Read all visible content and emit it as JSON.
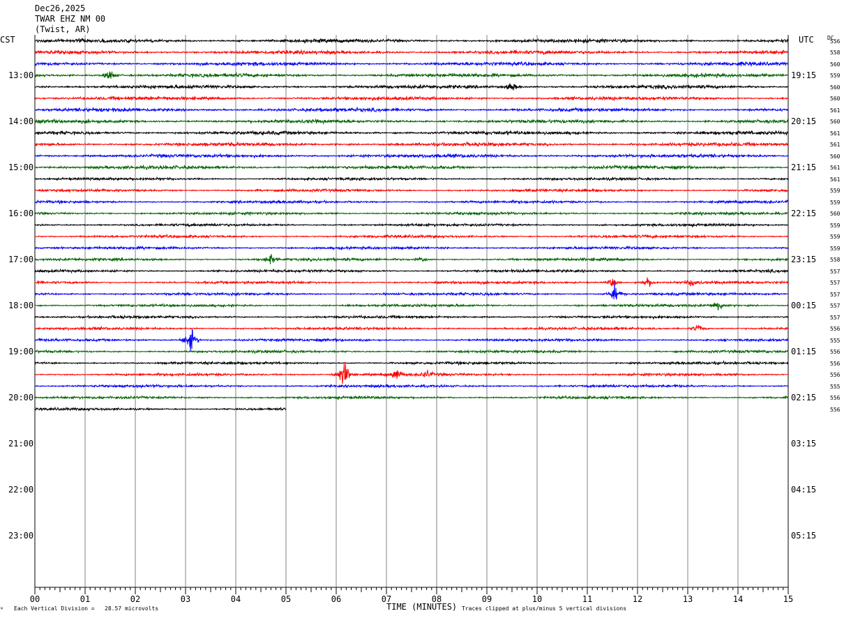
{
  "header": {
    "date": "Dec26,2025",
    "station": "TWAR EHZ NM 00",
    "location": "(Twist, AR)",
    "left_timezone": "CST",
    "right_timezone": "UTC",
    "dc_label": "DC"
  },
  "footer": {
    "vertical_division": "Each Vertical Division =   28.57 microvolts",
    "axis_title": "TIME (MINUTES)",
    "clip_note": "Traces clipped at plus/minus 5 vertical divisions"
  },
  "chart_data": {
    "type": "line",
    "title": "TWAR EHZ NM 00",
    "xlabel": "TIME (MINUTES)",
    "xlim": [
      0,
      15
    ],
    "x_ticks": [
      "00",
      "01",
      "02",
      "03",
      "04",
      "05",
      "06",
      "07",
      "08",
      "09",
      "10",
      "11",
      "12",
      "13",
      "14",
      "15"
    ],
    "y_left_labels": [
      "13:00",
      "14:00",
      "15:00",
      "16:00",
      "17:00",
      "18:00",
      "19:00",
      "20:00",
      "21:00",
      "22:00",
      "23:00"
    ],
    "y_right_labels": [
      "19:15",
      "20:15",
      "21:15",
      "22:15",
      "23:15",
      "00:15",
      "01:15",
      "02:15",
      "03:15",
      "04:15",
      "05:15"
    ],
    "trace_colors": [
      "#000000",
      "#ff0000",
      "#0000ff",
      "#006400"
    ],
    "trace_count": 33,
    "last_trace_end_minute": 5,
    "dc_offsets": [
      556,
      558,
      560,
      559,
      560,
      560,
      561,
      560,
      561,
      561,
      560,
      561,
      561,
      559,
      559,
      560,
      559,
      559,
      559,
      558,
      557,
      557,
      557,
      557,
      557,
      556,
      555,
      556,
      556,
      556,
      555,
      556,
      556
    ],
    "events": [
      {
        "trace": 4,
        "minute": 9.5,
        "amplitude": 1.5
      },
      {
        "trace": 3,
        "minute": 1.5,
        "amplitude": 2
      },
      {
        "trace": 19,
        "minute": 4.7,
        "amplitude": 2
      },
      {
        "trace": 19,
        "minute": 7.7,
        "amplitude": 1.2
      },
      {
        "trace": 21,
        "minute": 11.5,
        "amplitude": 1.5
      },
      {
        "trace": 21,
        "minute": 12.2,
        "amplitude": 2
      },
      {
        "trace": 21,
        "minute": 13.1,
        "amplitude": 1.5
      },
      {
        "trace": 22,
        "minute": 11.55,
        "amplitude": 3
      },
      {
        "trace": 23,
        "minute": 13.6,
        "amplitude": 2
      },
      {
        "trace": 25,
        "minute": 13.2,
        "amplitude": 1.5
      },
      {
        "trace": 26,
        "minute": 3.1,
        "amplitude": 5
      },
      {
        "trace": 29,
        "minute": 6.15,
        "amplitude": 5
      },
      {
        "trace": 29,
        "minute": 7.2,
        "amplitude": 2
      },
      {
        "trace": 29,
        "minute": 7.8,
        "amplitude": 1.2
      }
    ]
  }
}
